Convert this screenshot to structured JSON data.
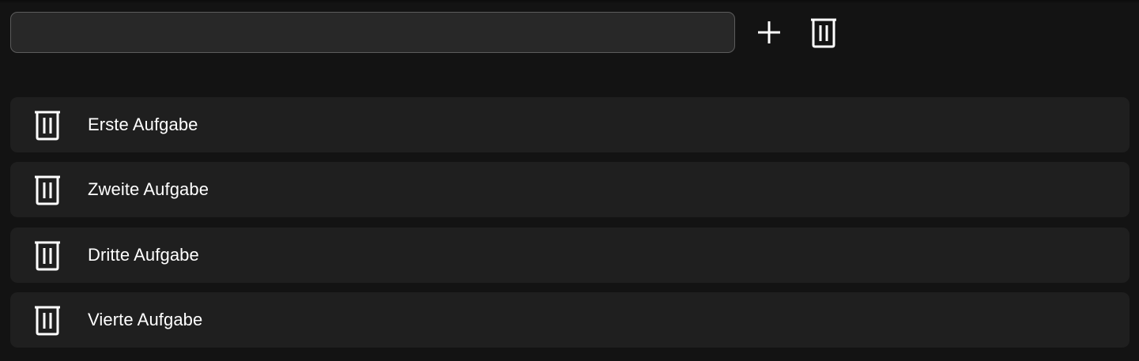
{
  "toolbar": {
    "input_value": "",
    "input_placeholder": "",
    "add_icon": "plus-icon",
    "clear_icon": "trash-icon"
  },
  "tasks": [
    {
      "label": "Erste Aufgabe",
      "delete_icon": "trash-icon"
    },
    {
      "label": "Zweite Aufgabe",
      "delete_icon": "trash-icon"
    },
    {
      "label": "Dritte Aufgabe",
      "delete_icon": "trash-icon"
    },
    {
      "label": "Vierte Aufgabe",
      "delete_icon": "trash-icon"
    }
  ],
  "colors": {
    "background": "#131313",
    "input_background": "#282828",
    "input_border": "#5c5c5c",
    "item_background": "#1f1f1f",
    "icon": "#ffffff",
    "text": "#ffffff"
  }
}
